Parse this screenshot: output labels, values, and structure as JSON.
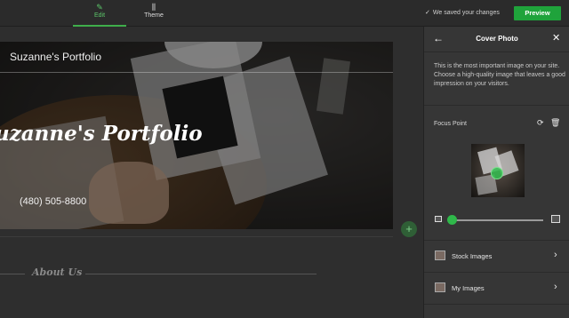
{
  "topbar": {
    "tabs": [
      {
        "label": "Edit",
        "icon": "pencil-icon"
      },
      {
        "label": "Theme",
        "icon": "theme-bars-icon"
      }
    ],
    "saved_status": "We saved your changes",
    "preview_label": "Preview"
  },
  "canvas": {
    "hero": {
      "site_title": "Suzanne's Portfolio",
      "big_title": "uzanne's Portfolio",
      "phone": "(480) 505-8800"
    },
    "add_section_symbol": "+",
    "about_title": "About Us"
  },
  "panel": {
    "title": "Cover Photo",
    "description": "This is the most important image on your site. Choose a high-quality image that leaves a good impression on your visitors.",
    "focus_point_label": "Focus Point",
    "zoom_level": 0.0,
    "options": [
      {
        "label": "Stock Images",
        "icon": "stock-images-icon"
      },
      {
        "label": "My Images",
        "icon": "my-images-icon"
      }
    ]
  },
  "colors": {
    "accent": "#1fa33b",
    "panel_bg": "#363636",
    "topbar_bg": "#2b2b2b"
  }
}
